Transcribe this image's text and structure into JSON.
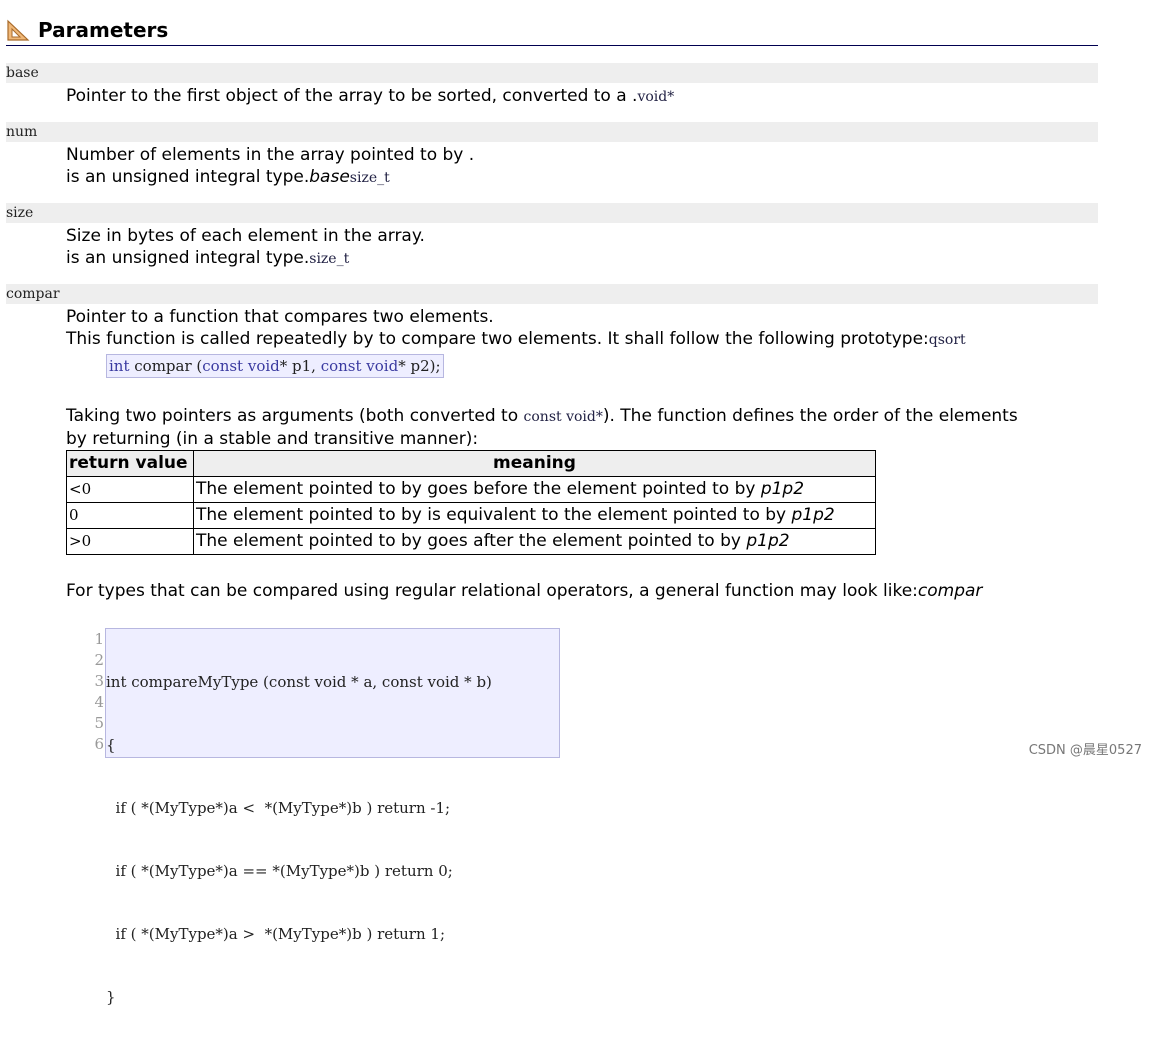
{
  "section": {
    "title": "Parameters",
    "icon": "ruler-triangle-icon"
  },
  "params": [
    {
      "name": "base",
      "lines": [
        {
          "text": "Pointer to the first object of the array to be sorted, converted to a .",
          "code": "void*"
        }
      ]
    },
    {
      "name": "num",
      "lines": [
        {
          "text": "Number of elements in the array pointed to by ."
        },
        {
          "text": "is an unsigned integral type.",
          "italic": "base",
          "code": "size_t"
        }
      ]
    },
    {
      "name": "size",
      "lines": [
        {
          "text": "Size in bytes of each element in the array."
        },
        {
          "text": "is an unsigned integral type.",
          "code": "size_t"
        }
      ]
    },
    {
      "name": "compar",
      "lines": [
        {
          "text": "Pointer to a function that compares two elements."
        },
        {
          "text": "This function is called repeatedly by to compare two elements. It shall follow the following prototype:",
          "code": "qsort"
        }
      ]
    }
  ],
  "prototype": {
    "kw1": "int",
    "rest1": " compar (",
    "kw2": "const void",
    "rest2": "* p1, ",
    "kw3": "const void",
    "rest3": "* p2);"
  },
  "description": {
    "line1_a": "Taking two pointers as arguments (both converted to ",
    "line1_code": "const void*",
    "line1_b": "). The function defines the order of the elements",
    "line2": "by returning (in a stable and transitive manner):"
  },
  "return_table": {
    "headers": [
      "return value",
      "meaning"
    ],
    "rows": [
      {
        "value": "<0",
        "meaning": "The element pointed to by goes before the element pointed to by ",
        "italic": "p1p2"
      },
      {
        "value": "0",
        "meaning": "The element pointed to by is equivalent to the element pointed to by ",
        "italic": "p1p2"
      },
      {
        "value": ">0",
        "meaning": "The element pointed to by goes after the element pointed to by ",
        "italic": "p1p2"
      }
    ]
  },
  "general_text": {
    "text": "For types that can be compared using regular relational operators, a general function may look like:",
    "italic": "compar"
  },
  "code_example": {
    "line_numbers": [
      "1",
      "2",
      "3",
      "4",
      "5",
      "6"
    ],
    "lines": [
      "int compareMyType (const void * a, const void * b)",
      "{",
      "  if ( *(MyType*)a <  *(MyType*)b ) return -1;",
      "  if ( *(MyType*)a == *(MyType*)b ) return 0;",
      "  if ( *(MyType*)a >  *(MyType*)b ) return 1;",
      "}"
    ]
  },
  "watermark": "CSDN @晨星0527"
}
